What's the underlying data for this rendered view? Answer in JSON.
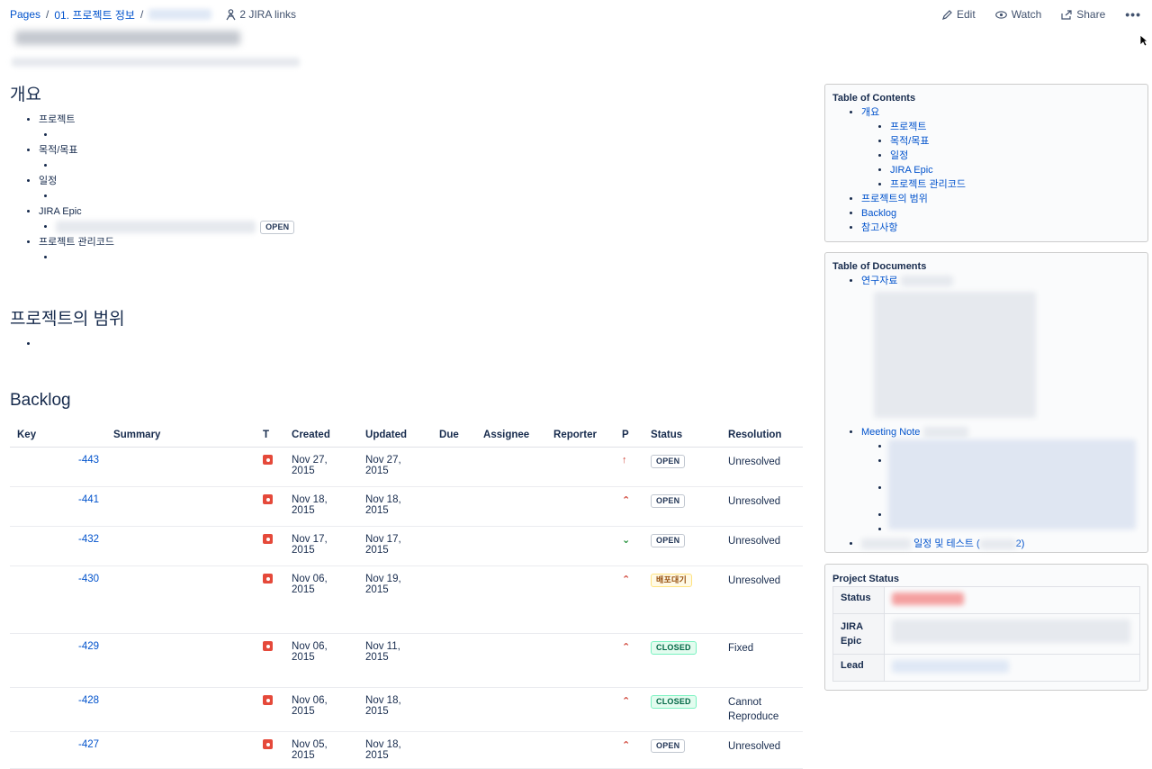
{
  "breadcrumb": {
    "pages": "Pages",
    "sep": "/",
    "parent": "01. 프로젝트 정보",
    "jira_links": "2 JIRA links"
  },
  "actions": {
    "edit": "Edit",
    "watch": "Watch",
    "share": "Share",
    "more": "•••"
  },
  "overview": {
    "heading": "개요",
    "items": [
      "프로젝트",
      "목적/목표",
      "일정",
      "JIRA Epic",
      "프로젝트 관리코드"
    ],
    "epic_status": "OPEN"
  },
  "scope": {
    "heading": "프로젝트의 범위"
  },
  "backlog": {
    "heading": "Backlog",
    "columns": [
      "Key",
      "Summary",
      "T",
      "Created",
      "Updated",
      "Due",
      "Assignee",
      "Reporter",
      "P",
      "Status",
      "Resolution"
    ],
    "rows": [
      {
        "key": "-443",
        "created": "Nov 27, 2015",
        "updated": "Nov 27, 2015",
        "priority": "↑",
        "status": "OPEN",
        "resolution": "Unresolved"
      },
      {
        "key": "-441",
        "created": "Nov 18, 2015",
        "updated": "Nov 18, 2015",
        "priority": "⌃",
        "status": "OPEN",
        "resolution": "Unresolved"
      },
      {
        "key": "-432",
        "created": "Nov 17, 2015",
        "updated": "Nov 17, 2015",
        "priority": "⌄",
        "status": "OPEN",
        "resolution": "Unresolved"
      },
      {
        "key": "-430",
        "created": "Nov 06, 2015",
        "updated": "Nov 19, 2015",
        "priority": "⌃",
        "status": "배포대기",
        "resolution": "Unresolved"
      },
      {
        "key": "-429",
        "created": "Nov 06, 2015",
        "updated": "Nov 11, 2015",
        "priority": "⌃",
        "status": "CLOSED",
        "resolution": "Fixed"
      },
      {
        "key": "-428",
        "created": "Nov 06, 2015",
        "updated": "Nov 18, 2015",
        "priority": "⌃",
        "status": "CLOSED",
        "resolution": "Cannot Reproduce"
      },
      {
        "key": "-427",
        "created": "Nov 05, 2015",
        "updated": "Nov 18, 2015",
        "priority": "⌃",
        "status": "OPEN",
        "resolution": "Unresolved"
      }
    ]
  },
  "toc": {
    "title": "Table of Contents",
    "items": [
      "개요",
      "프로젝트",
      "목적/목표",
      "일정",
      "JIRA Epic",
      "프로젝트 관리코드",
      "프로젝트의 범위",
      "Backlog",
      "참고사항"
    ]
  },
  "documents": {
    "title": "Table of Documents",
    "research": "연구자료",
    "meeting": "Meeting Note",
    "schedule": "일정 및 테스트 (",
    "schedule_suffix": "2)"
  },
  "project_status": {
    "title": "Project Status",
    "labels": [
      "Status",
      "JIRA Epic",
      "Lead"
    ]
  }
}
